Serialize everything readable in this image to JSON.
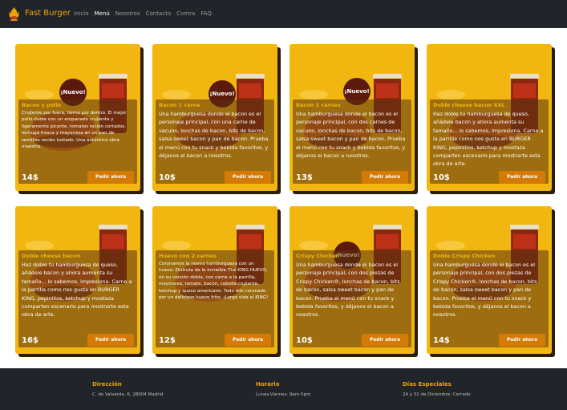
{
  "brand": "Fast Burger",
  "nav": [
    {
      "label": "Inicio",
      "active": false
    },
    {
      "label": "Menú",
      "active": true
    },
    {
      "label": "Nosotros",
      "active": false
    },
    {
      "label": "Contacto",
      "active": false
    },
    {
      "label": "Comra",
      "active": false
    },
    {
      "label": "FAQ",
      "active": false
    }
  ],
  "badge_label": "¡Nuevo!",
  "order_label": "Pedir ahora",
  "cards": [
    {
      "title": "Bacon y pollo",
      "new": true,
      "price": "14$",
      "desc": "Crujiente por fuera, tierno por dentro. El mejor pollo doble con un empanado crujiente y ligeramente picante, tomates recién cortados, lechuga fresca y mayonesa en un pan de semillas recién tostado. Una auténtica obra maestra."
    },
    {
      "title": "Bacon 1 carne",
      "new": true,
      "price": "10$",
      "desc": "Una hamburguesa donde el bacon es el personaje principal, con una carne de vacuno, lonchas de bacon, bits de bacon, salsa sweet bacon y pan de bacon. Prueba el menú con tu snack y bebida favoritos, y déjanos el bacon a nosotros."
    },
    {
      "title": "Bacon 2 carnes",
      "new": true,
      "price": "13$",
      "desc": "Una hamburguesa donde el bacon es el personaje principal, con dos carnes de vacuno, lonchas de bacon, bits de bacon, salsa sweet bacon y pan de bacon. Prueba el menú con tu snack y bebida favoritos, y déjanos el bacon a nosotros."
    },
    {
      "title": "Doble cheese bacon XXL",
      "new": false,
      "price": "10$",
      "desc": "Haz doble tu hamburguesa de queso, añádele bacon y ahora aumenta su tamaño... lo sabemos, impresiona. Carne a la parrilla como nos gusta en BURGER KING, pepinillos, ketchup y mostaza comparten escenario para mostrarte esta obra de arte."
    },
    {
      "title": "Doble cheese bacon",
      "new": false,
      "price": "16$",
      "desc": "Haz doble tu hamburguesa de queso, añádele bacon y ahora aumenta su tamaño... lo sabemos, impresiona. Carne a la parrilla como nos gusta en BURGER KING, pepinillos, ketchup y mostaza comparten escenario para mostrarte esta obra de arte."
    },
    {
      "title": "Huevo con 2 carnes",
      "new": false,
      "price": "12$",
      "desc": "Coronamos la nueva hamburguesa con un huevo. Disfruta de la increíble The KING HUEVO, en su versión doble, con carne a la parrilla, mayonesa, tomate, bacon, cebolla crujiente, ketchup y queso americano. Todo ello coronado por un delicioso huevo frito. ¡Larga vida al KING!"
    },
    {
      "title": "Crispy Chicken",
      "new": true,
      "price": "10$",
      "desc": "Una hamburguesa donde el bacon es el personaje principal, con dos piezas de Crispy Chicken®, lonchas de bacon, bits de bacon, salsa sweet bacon y pan de bacon. Prueba el menú con tu snack y bebida favoritos, y déjanos el bacon a nosotros."
    },
    {
      "title": "Doble Crispy Chicken",
      "new": false,
      "price": "14$",
      "desc": "Una hamburguesa donde el bacon es el personaje principal, con dos piezas de Crispy Chicken®, lonchas de bacon, bits de bacon, salsa sweet bacon y pan de bacon. Prueba el menú con tu snack y bebida favoritos, y déjanos el bacon a nosotros."
    }
  ],
  "footer": {
    "address_title": "Dirección",
    "address": "C. de Valverde, 6, 28004 Madrid",
    "hours_title": "Horario",
    "hours": "Lunes-Viernes: 9am-5pm",
    "special_title": "Días Especiales",
    "special": "24 y 31 de Diciembre: Cerrado"
  },
  "colors": {
    "accent": "#f2b611",
    "button": "#d47a06",
    "badge": "#5c1a0c",
    "dark": "#212529"
  }
}
